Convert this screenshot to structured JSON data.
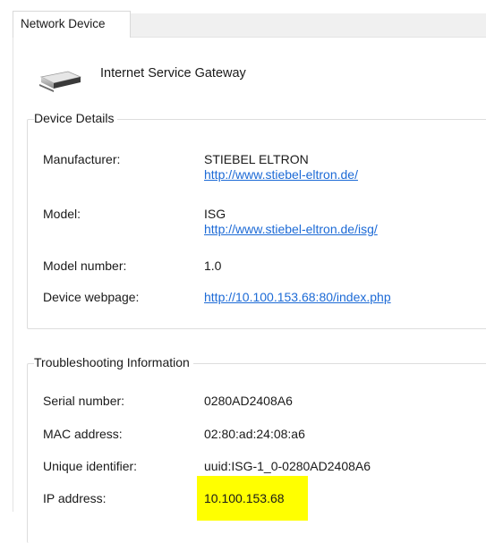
{
  "tab": {
    "label": "Network Device"
  },
  "header": {
    "device_name": "Internet Service Gateway",
    "icon": "router-icon"
  },
  "device_details": {
    "title": "Device Details",
    "manufacturer_label": "Manufacturer:",
    "manufacturer_value": "STIEBEL ELTRON",
    "manufacturer_url": "http://www.stiebel-eltron.de/",
    "model_label": "Model:",
    "model_value": "ISG",
    "model_url": "http://www.stiebel-eltron.de/isg/",
    "model_number_label": "Model number:",
    "model_number_value": "1.0",
    "webpage_label": "Device webpage:",
    "webpage_url": "http://10.100.153.68:80/index.php"
  },
  "troubleshooting": {
    "title": "Troubleshooting Information",
    "serial_label": "Serial number:",
    "serial_value": "0280AD2408A6",
    "mac_label": "MAC address:",
    "mac_value": "02:80:ad:24:08:a6",
    "uid_label": "Unique identifier:",
    "uid_value": "uuid:ISG-1_0-0280AD2408A6",
    "ip_label": "IP address:",
    "ip_value": "10.100.153.68",
    "highlight_color": "#ffff00"
  }
}
